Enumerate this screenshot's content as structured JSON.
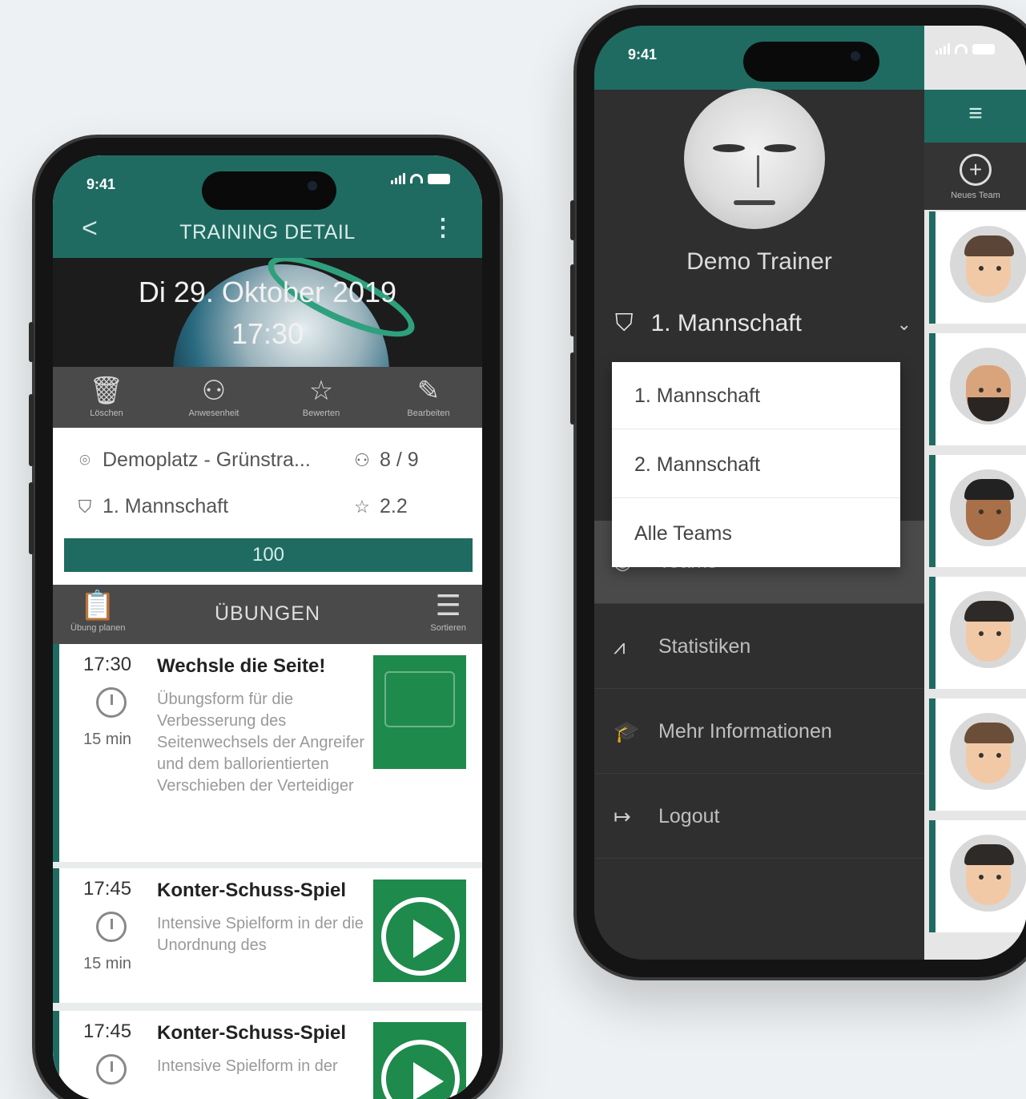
{
  "phone_left": {
    "status": {
      "time": "9:41"
    },
    "appbar": {
      "back": "<",
      "title": "TRAINING DETAIL",
      "more": "⋮"
    },
    "header": {
      "date": "Di 29. Oktober 2019",
      "time": "17:30"
    },
    "actions": [
      {
        "icon": "trash-icon",
        "label": "Löschen"
      },
      {
        "icon": "attendance-icon",
        "label": "Anwesenheit"
      },
      {
        "icon": "star-icon",
        "label": "Bewerten"
      },
      {
        "icon": "pencil-icon",
        "label": "Bearbeiten"
      }
    ],
    "info": {
      "location": "Demoplatz - Grünstra...",
      "attendance": "8 / 9",
      "team": "1. Mannschaft",
      "rating": "2.2",
      "progress_label": "100",
      "progress_value": 100
    },
    "exercises_header": {
      "title": "ÜBUNGEN",
      "left_label": "Übung planen",
      "right_label": "Sortieren"
    },
    "exercises": [
      {
        "time": "17:30",
        "name": "Wechsle die Seite!",
        "duration": "15 min",
        "description": "Übungsform für die Verbesserung des Seitenwechsels der Angreifer und dem ballorientierten Verschieben der Verteidiger"
      },
      {
        "time": "17:45",
        "name": "Konter-Schuss-Spiel",
        "duration": "15 min",
        "description": "Intensive Spielform in der die Unordnung des"
      },
      {
        "time": "17:45",
        "name": "Konter-Schuss-Spiel",
        "duration": "",
        "description": "Intensive Spielform in der"
      }
    ]
  },
  "phone_right": {
    "status": {
      "time": "9:41"
    },
    "trainer_name": "Demo Trainer",
    "selected_team": "1. Mannschaft",
    "dropdown_options": [
      "1. Mannschaft",
      "2. Mannschaft",
      "Alle Teams"
    ],
    "menu": [
      {
        "icon": "teams-icon",
        "label": "Teams"
      },
      {
        "icon": "statistics-icon",
        "label": "Statistiken"
      },
      {
        "icon": "graduation-cap-icon",
        "label": "Mehr Informationen"
      },
      {
        "icon": "logout-icon",
        "label": "Logout"
      }
    ],
    "team_panel": {
      "new_team_label": "Neues Team"
    }
  },
  "colors": {
    "primary": "#1f6b61",
    "dark_bg": "#2f2f2f",
    "toolbar": "#4a4a4a"
  }
}
